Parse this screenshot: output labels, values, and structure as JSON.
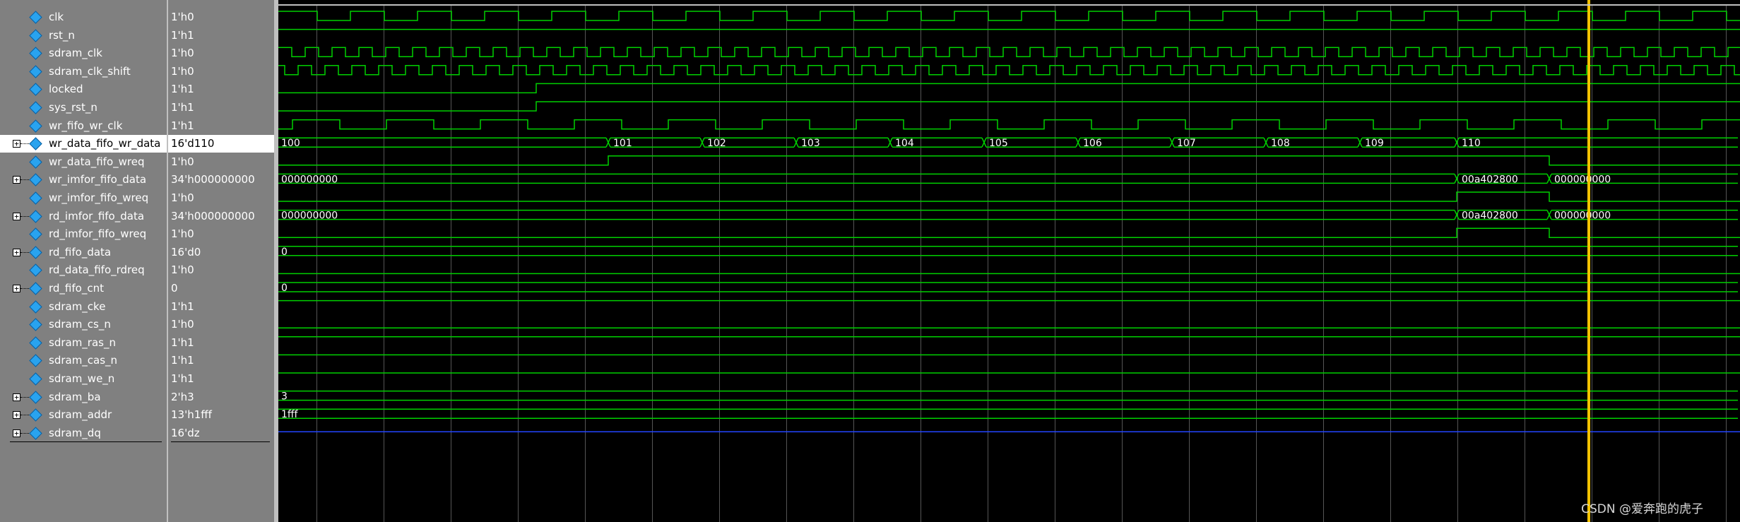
{
  "signals": [
    {
      "name": "clk",
      "value": "1'h0",
      "expandable": false
    },
    {
      "name": "rst_n",
      "value": "1'h1",
      "expandable": false
    },
    {
      "name": "sdram_clk",
      "value": "1'h0",
      "expandable": false
    },
    {
      "name": "sdram_clk_shift",
      "value": "1'h0",
      "expandable": false
    },
    {
      "name": "locked",
      "value": "1'h1",
      "expandable": false
    },
    {
      "name": "sys_rst_n",
      "value": "1'h1",
      "expandable": false
    },
    {
      "name": "wr_fifo_wr_clk",
      "value": "1'h1",
      "expandable": false
    },
    {
      "name": "wr_data_fifo_wr_data",
      "value": "16'd110",
      "expandable": true,
      "selected": true
    },
    {
      "name": "wr_data_fifo_wreq",
      "value": "1'h0",
      "expandable": false
    },
    {
      "name": "wr_imfor_fifo_data",
      "value": "34'h000000000",
      "expandable": true
    },
    {
      "name": "wr_imfor_fifo_wreq",
      "value": "1'h0",
      "expandable": false
    },
    {
      "name": "rd_imfor_fifo_data",
      "value": "34'h000000000",
      "expandable": true
    },
    {
      "name": "rd_imfor_fifo_wreq",
      "value": "1'h0",
      "expandable": false
    },
    {
      "name": "rd_fifo_data",
      "value": "16'd0",
      "expandable": true
    },
    {
      "name": "rd_data_fifo_rdreq",
      "value": "1'h0",
      "expandable": false
    },
    {
      "name": "rd_fifo_cnt",
      "value": "0",
      "expandable": true
    },
    {
      "name": "sdram_cke",
      "value": "1'h1",
      "expandable": false
    },
    {
      "name": "sdram_cs_n",
      "value": "1'h0",
      "expandable": false
    },
    {
      "name": "sdram_ras_n",
      "value": "1'h1",
      "expandable": false
    },
    {
      "name": "sdram_cas_n",
      "value": "1'h1",
      "expandable": false
    },
    {
      "name": "sdram_we_n",
      "value": "1'h1",
      "expandable": false
    },
    {
      "name": "sdram_ba",
      "value": "2'h3",
      "expandable": true
    },
    {
      "name": "sdram_addr",
      "value": "13'h1fff",
      "expandable": true
    },
    {
      "name": "sdram_dq",
      "value": "16'dz",
      "expandable": true
    }
  ],
  "bus_labels": {
    "wr_data_fifo_wr_data": [
      "100",
      "101",
      "102",
      "103",
      "104",
      "105",
      "106",
      "107",
      "108",
      "109",
      "110"
    ],
    "wr_imfor_fifo_data": [
      "000000000",
      "00a402800",
      "000000000"
    ],
    "rd_imfor_fifo_data": [
      "000000000",
      "00a402800",
      "000000000"
    ],
    "rd_fifo_data": [
      "0"
    ],
    "rd_fifo_cnt": [
      "0"
    ],
    "sdram_ba": [
      "3"
    ],
    "sdram_addr": [
      "1fff"
    ]
  },
  "colors": {
    "wave": "#00d000",
    "cursor": "#f2c200",
    "grid": "#555555",
    "hiz": "#2244ff",
    "panel": "#808080"
  },
  "watermark": "CSDN @爱奔跑的虎子"
}
